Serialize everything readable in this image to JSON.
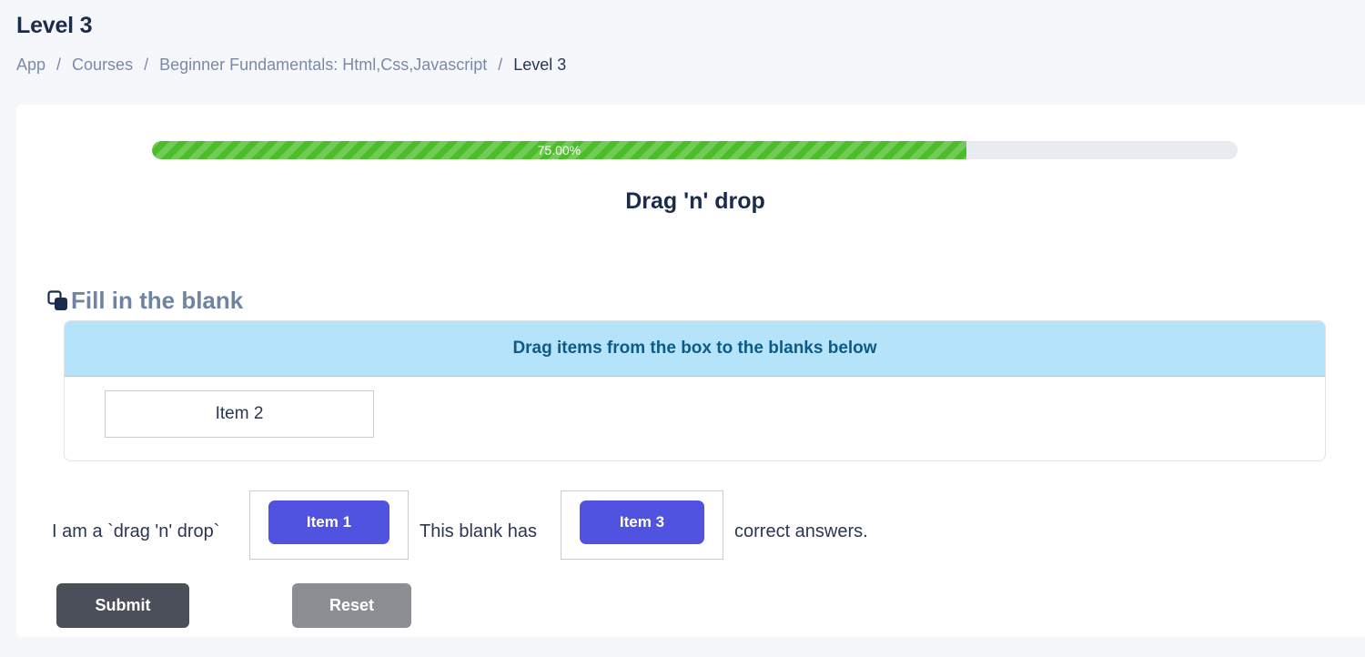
{
  "page": {
    "title": "Level 3"
  },
  "breadcrumb": {
    "items": [
      "App",
      "Courses",
      "Beginner Fundamentals: Html,Css,Javascript",
      "Level 3"
    ],
    "separator": "/"
  },
  "progress": {
    "value": 0.75,
    "label": "75.00%",
    "color": "#4bbd28"
  },
  "activity": {
    "title": "Drag 'n' drop"
  },
  "section": {
    "icon": "copy-squares-icon",
    "heading": "Fill in the blank"
  },
  "drag_box": {
    "instructions": "Drag items from the box to the blanks below",
    "items": [
      "Item 2"
    ]
  },
  "sentence": {
    "part_1": "I am a `drag 'n' drop`",
    "blank_1": "Item 1",
    "part_2": "This blank has",
    "blank_2": "Item 3",
    "part_3": "correct answers."
  },
  "actions": {
    "submit_label": "Submit",
    "reset_label": "Reset"
  },
  "colors": {
    "chip": "#5053e0",
    "instructions_bg": "#b5e4fa",
    "submit": "#4a4f59",
    "reset": "#8b8e93"
  }
}
